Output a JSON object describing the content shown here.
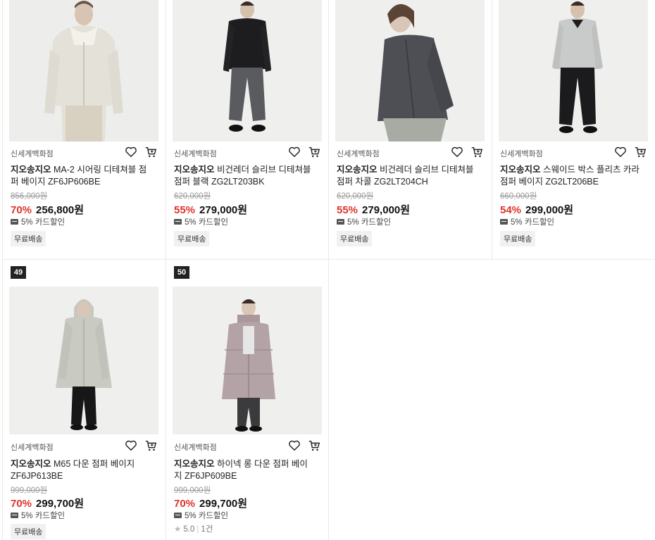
{
  "colors": {
    "discount": "#e0322b",
    "rank_badge": "#222222",
    "divider": "#e9e9e9"
  },
  "products": [
    {
      "rank": "",
      "store": "신세계백화점",
      "brand": "지오송지오",
      "name": "MA-2 시어링 디테쳐블 점퍼 베이지 ZF6JP606BE",
      "original_price": "856,000원",
      "discount_rate": "70%",
      "price": "256,800원",
      "card_discount": "5% 카드할인",
      "badge": "무료배송",
      "image_subject": "beige-shearling-jacket"
    },
    {
      "rank": "",
      "store": "신세계백화점",
      "brand": "지오송지오",
      "name": "비건레더 슬리브 디테쳐블 점퍼 블랙 ZG2LT203BK",
      "original_price": "620,000원",
      "discount_rate": "55%",
      "price": "279,000원",
      "card_discount": "5% 카드할인",
      "badge": "무료배송",
      "image_subject": "black-jacket"
    },
    {
      "rank": "",
      "store": "신세계백화점",
      "brand": "지오송지오",
      "name": "비건레더 슬리브 디테쳐블 점퍼 차콜 ZG2LT204CH",
      "original_price": "620,000원",
      "discount_rate": "55%",
      "price": "279,000원",
      "card_discount": "5% 카드할인",
      "badge": "무료배송",
      "image_subject": "charcoal-jacket"
    },
    {
      "rank": "",
      "store": "신세계백화점",
      "brand": "지오송지오",
      "name": "스웨이드 박스 플리츠 카라 점퍼 베이지 ZG2LT206BE",
      "original_price": "660,000원",
      "discount_rate": "54%",
      "price": "299,000원",
      "card_discount": "5% 카드할인",
      "badge": "무료배송",
      "image_subject": "grey-suede-jacket"
    },
    {
      "rank": "49",
      "store": "신세계백화점",
      "brand": "지오송지오",
      "name": "M65 다운 점퍼 베이지 ZF6JP613BE",
      "original_price": "999,000원",
      "discount_rate": "70%",
      "price": "299,700원",
      "card_discount": "5% 카드할인",
      "badge": "무료배송",
      "image_subject": "beige-hooded-down-parka"
    },
    {
      "rank": "50",
      "store": "신세계백화점",
      "brand": "지오송지오",
      "name": "하이넥 롱 다운 점퍼 베이지 ZF6JP609BE",
      "original_price": "999,000원",
      "discount_rate": "70%",
      "price": "299,700원",
      "card_discount": "5% 카드할인",
      "rating": "5.0",
      "review_count": "1건",
      "image_subject": "mauve-long-down-coat"
    }
  ]
}
